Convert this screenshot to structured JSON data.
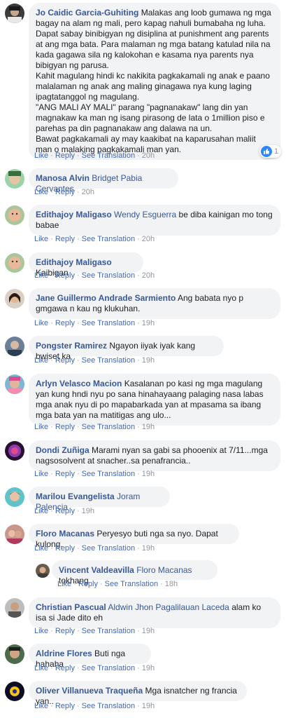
{
  "actions": {
    "like": "Like",
    "reply": "Reply",
    "see_translation": "See Translation",
    "separator": "·"
  },
  "comments": [
    {
      "author": "Jo Caidic Garcia-Guhiting",
      "tag": "",
      "paragraphs": [
        "Malakas ang loob gumawa ng mga bagay na alam ng mali, pero kapag nahuli bumabaha ng luha.",
        "Dapat sabay binibigyan ng disiplina at punishment ang parents at ang mga bata. Para malaman ng mga batang katulad nila na kada gagawa sila ng kalokohan e kasama nya parents nya bibigyan ng parusa.",
        "Kahit magulang hindi kc nakikita pagkakamali ng anak e paano malalaman ng anak ang maling ginagawa nya kung laging ipagtatanggol ng magulang.",
        "\"ANG MALI AY MALI\" parang \"pagnanakaw\" lang din yan magnakaw ka man ng isang pirasong de lata o 1million piso e parehas pa din pagnanakaw ang dalawa na un.",
        "Bawat pagkakamali ay may kaakibat na kaparusahan maliit man o malaking pagkakamali man yan."
      ],
      "time": "20h",
      "translation": true,
      "reaction_count": "1"
    },
    {
      "author": "Manosa Alvin",
      "tag": "Bridget Pabia Cervantes",
      "paragraphs": [
        ""
      ],
      "time": "20h",
      "translation": false
    },
    {
      "author": "Edithajoy Maligaso",
      "tag": "Wendy Esguerra",
      "paragraphs": [
        "be diba kainigan mo tong babae"
      ],
      "time": "20h",
      "translation": true
    },
    {
      "author": "Edithajoy Maligaso",
      "tag": "",
      "paragraphs": [
        "Kaibigan"
      ],
      "time": "20h",
      "translation": true
    },
    {
      "author": "Jane Guillermo Andrade Sarmiento",
      "tag": "",
      "paragraphs": [
        "Ang babata nyo p gmgawa n kau ng klukuhan."
      ],
      "time": "19h",
      "translation": true
    },
    {
      "author": "Pongster Ramirez",
      "tag": "",
      "paragraphs": [
        "Ngayon iiyak iyak kang bwiset ka"
      ],
      "time": "19h",
      "translation": true
    },
    {
      "author": "Arlyn Velasco Macion",
      "tag": "",
      "paragraphs": [
        "Kasalanan po kasi ng mga magulang yan kung hndi nyu po sana hinahayaang palaging nasa labas mga anak nyu di po mapabarkada yan at mpasama sa ibang mga bata yan na matitigas ang ulo..."
      ],
      "time": "19h",
      "translation": true
    },
    {
      "author": "Dondi Zuñiga",
      "tag": "",
      "paragraphs": [
        "Marami nyan sa gabi sa phooenix at 7/11...mga nagsosolvent at snacher..sa penafrancia.."
      ],
      "time": "19h",
      "translation": true
    },
    {
      "author": "Marilou Evangelista",
      "tag": "Joram Palencia",
      "paragraphs": [
        ""
      ],
      "time": "19h",
      "translation": false
    },
    {
      "author": "Floro Macanas",
      "tag": "",
      "paragraphs": [
        "Peryesyo buti nga sa nyo. Dapat kulong."
      ],
      "time": "19h",
      "translation": true
    },
    {
      "author": "Vincent Valdeavilla",
      "tag": "Floro Macanas",
      "paragraphs": [
        "tokhang"
      ],
      "time": "18h",
      "translation": true,
      "reply": true
    },
    {
      "author": "Christian Pascual",
      "tag": "Aldwin Jhon Pagalilauan Laceda",
      "paragraphs": [
        "alam ko isa si Jade dito eh"
      ],
      "time": "19h",
      "translation": true
    },
    {
      "author": "Aldrine Flores",
      "tag": "",
      "paragraphs": [
        "Buti nga hahaha"
      ],
      "time": "19h",
      "translation": true
    },
    {
      "author": "Oliver Villanueva Traqueña",
      "tag": "",
      "paragraphs": [
        "Mga isnatcher ng francia yan.."
      ],
      "time": "19h",
      "translation": true
    }
  ],
  "colors": {
    "link": "#385898",
    "bubble": "#f2f3f5",
    "meta": "#90949c",
    "like_blue": "#2d88ff"
  }
}
